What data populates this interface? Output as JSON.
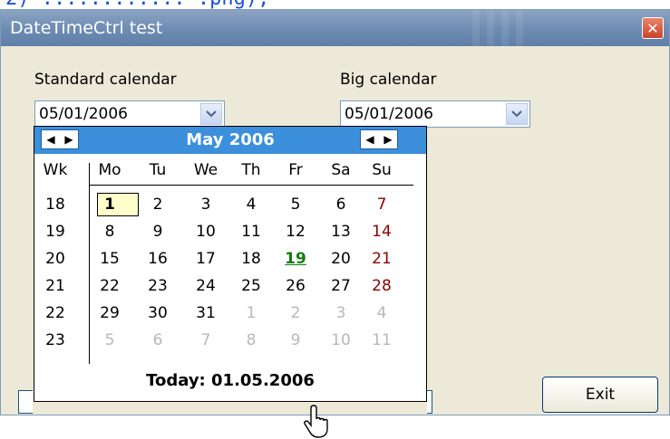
{
  "strip": {
    "text": "2) ............ .png),"
  },
  "window": {
    "title": "DateTimeCtrl test",
    "close_icon": "close-icon"
  },
  "standard": {
    "label": "Standard calendar",
    "value": "05/01/2006"
  },
  "big": {
    "label": "Big calendar",
    "value": "05/01/2006"
  },
  "calendar": {
    "month_label": "May 2006",
    "header_color": "#3b8fdb",
    "weekday_headers": [
      "Wk",
      "Mo",
      "Tu",
      "We",
      "Th",
      "Fr",
      "Sa",
      "Su"
    ],
    "weeks": [
      {
        "wk": "18",
        "days": [
          "1",
          "2",
          "3",
          "4",
          "5",
          "6",
          "7"
        ]
      },
      {
        "wk": "19",
        "days": [
          "8",
          "9",
          "10",
          "11",
          "12",
          "13",
          "14"
        ]
      },
      {
        "wk": "20",
        "days": [
          "15",
          "16",
          "17",
          "18",
          "19",
          "20",
          "21"
        ]
      },
      {
        "wk": "21",
        "days": [
          "22",
          "23",
          "24",
          "25",
          "26",
          "27",
          "28"
        ]
      },
      {
        "wk": "22",
        "days": [
          "29",
          "30",
          "31",
          "1",
          "2",
          "3",
          "4"
        ]
      },
      {
        "wk": "23",
        "days": [
          "5",
          "6",
          "7",
          "8",
          "9",
          "10",
          "11"
        ]
      }
    ],
    "selected_day": "1",
    "hover_day": "19",
    "sunday_color": "#8b0000",
    "today_label": "Today: 01.05.2006"
  },
  "exit": {
    "label": "Exit"
  }
}
